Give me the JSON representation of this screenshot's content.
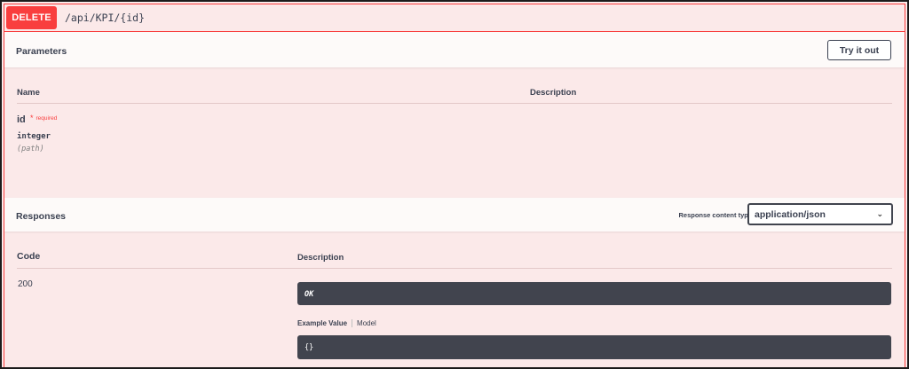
{
  "operation": {
    "method": "DELETE",
    "path": "/api/KPI/{id}"
  },
  "parameters": {
    "title": "Parameters",
    "try_label": "Try it out",
    "columns": {
      "name": "Name",
      "description": "Description"
    },
    "items": [
      {
        "name": "id",
        "required": "required",
        "type": "integer",
        "in": "(path)"
      }
    ]
  },
  "responses": {
    "title": "Responses",
    "content_type_label": "Response content type",
    "content_type_value": "application/json",
    "columns": {
      "code": "Code",
      "description": "Description"
    },
    "items": [
      {
        "code": "200",
        "description": "OK",
        "example_tab": "Example Value",
        "model_tab": "Model",
        "example": "{}"
      }
    ]
  },
  "colors": {
    "delete": "#f93e3e",
    "background": "#fbe9e9",
    "code_block": "#41444e"
  },
  "icons": {
    "select_chevron": "chevron-down-icon"
  }
}
